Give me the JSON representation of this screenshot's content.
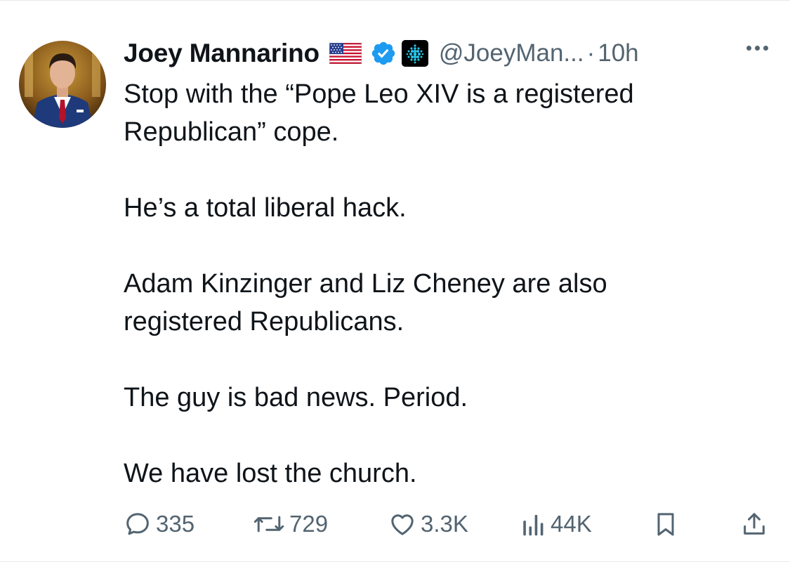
{
  "tweet": {
    "author": {
      "display_name": "Joey Mannarino",
      "handle": "@JoeyMan...",
      "flag_icon": "us-flag-icon",
      "verified_icon": "verified-badge-icon",
      "affiliation_icon": "affiliation-badge-icon"
    },
    "separator": "·",
    "time": "10h",
    "body": {
      "line1": "Stop with the “Pope Leo XIV is a registered",
      "line2": "Republican” cope.",
      "line3": "He’s a total liberal hack.",
      "line4": "Adam Kinzinger and Liz Cheney are also",
      "line5": "registered Republicans.",
      "line6": "The guy is bad news. Period.",
      "line7": "We have lost the church."
    },
    "actions": {
      "replies": "335",
      "reposts": "729",
      "likes": "3.3K",
      "views": "44K"
    },
    "colors": {
      "text": "#0f1419",
      "secondary": "#536471",
      "verified": "#1d9bf0"
    }
  }
}
